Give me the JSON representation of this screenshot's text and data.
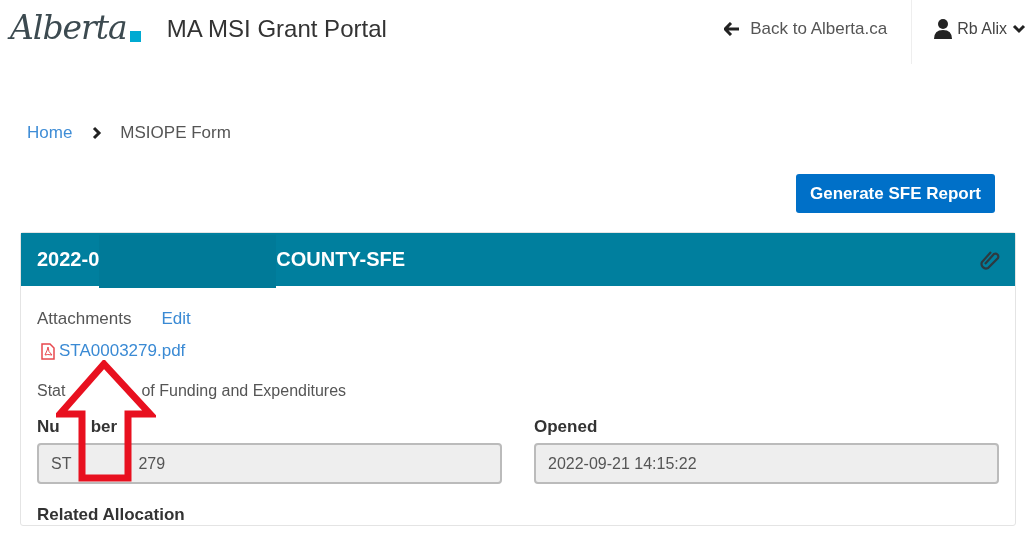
{
  "header": {
    "logo": "Alberta",
    "title": "MA MSI Grant Portal",
    "back_link": "Back to Alberta.ca",
    "user": "Rb Alix"
  },
  "breadcrumb": [
    {
      "label": "Home",
      "kind": "link"
    },
    {
      "label": "MSIOPE Form",
      "kind": "current"
    }
  ],
  "actions": {
    "generate_button": "Generate SFE Report"
  },
  "card": {
    "title_parts": [
      "2022-0",
      "COUNTY-SFE"
    ],
    "redacted": true,
    "attachments": {
      "label": "Attachments",
      "edit_link": "Edit",
      "files": [
        "STA0003279.pdf"
      ]
    },
    "form_title_parts": [
      "Stat",
      "of Funding and Expenditures"
    ],
    "fields": [
      {
        "label_parts": [
          "Nu",
          "ber"
        ],
        "value_parts": [
          "ST",
          "279"
        ]
      },
      {
        "label_parts": [
          "Opened"
        ],
        "value_parts": [
          "2022-09-21 14:15:22"
        ]
      }
    ],
    "section_label": "Related Allocation"
  },
  "annotation": {
    "kind": "arrow"
  }
}
